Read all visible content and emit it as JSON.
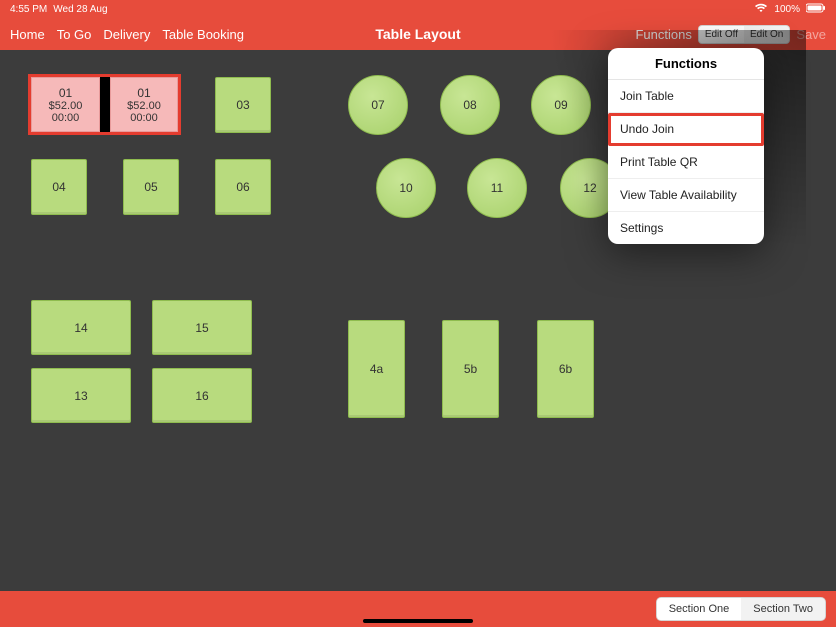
{
  "status": {
    "time": "4:55 PM",
    "date": "Wed 28 Aug",
    "wifi": "wifi-icon",
    "battery_pct": "100%",
    "battery_icon": "battery-icon"
  },
  "nav": {
    "items": [
      "Home",
      "To Go",
      "Delivery",
      "Table Booking"
    ],
    "title": "Table Layout",
    "functions_label": "Functions",
    "edit_off": "Edit Off",
    "edit_on": "Edit On",
    "save": "Save"
  },
  "popover": {
    "title": "Functions",
    "items": [
      "Join Table",
      "Undo Join",
      "Print Table QR",
      "View Table Availability",
      "Settings"
    ],
    "highlighted_index": 1
  },
  "tables": {
    "joined": {
      "a_num": "01",
      "a_amt": "$52.00",
      "a_time": "00:00",
      "b_num": "01",
      "b_amt": "$52.00",
      "b_time": "00:00"
    },
    "sq": {
      "t03": "03",
      "t04": "04",
      "t05": "05",
      "t06": "06",
      "t13": "13",
      "t14": "14",
      "t15": "15",
      "t16": "16",
      "t4a": "4a",
      "t5b": "5b",
      "t6b": "6b"
    },
    "circ": {
      "t07": "07",
      "t08": "08",
      "t09": "09",
      "t10": "10",
      "t11": "11",
      "t12": "12"
    }
  },
  "sections": {
    "one": "Section One",
    "two": "Section Two"
  }
}
